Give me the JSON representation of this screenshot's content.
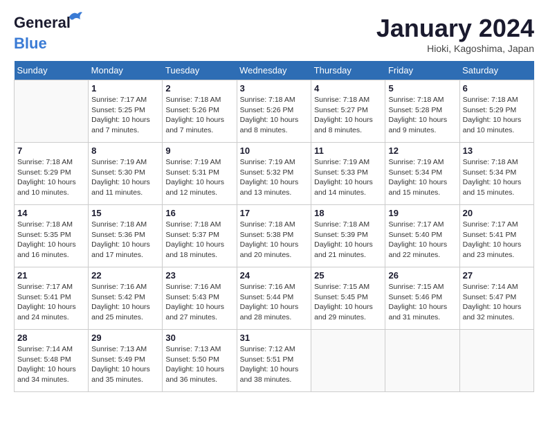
{
  "header": {
    "logo_line1": "General",
    "logo_line2": "Blue",
    "month": "January 2024",
    "location": "Hioki, Kagoshima, Japan"
  },
  "weekdays": [
    "Sunday",
    "Monday",
    "Tuesday",
    "Wednesday",
    "Thursday",
    "Friday",
    "Saturday"
  ],
  "weeks": [
    [
      {
        "day": "",
        "info": ""
      },
      {
        "day": "1",
        "info": "Sunrise: 7:17 AM\nSunset: 5:25 PM\nDaylight: 10 hours\nand 7 minutes."
      },
      {
        "day": "2",
        "info": "Sunrise: 7:18 AM\nSunset: 5:26 PM\nDaylight: 10 hours\nand 7 minutes."
      },
      {
        "day": "3",
        "info": "Sunrise: 7:18 AM\nSunset: 5:26 PM\nDaylight: 10 hours\nand 8 minutes."
      },
      {
        "day": "4",
        "info": "Sunrise: 7:18 AM\nSunset: 5:27 PM\nDaylight: 10 hours\nand 8 minutes."
      },
      {
        "day": "5",
        "info": "Sunrise: 7:18 AM\nSunset: 5:28 PM\nDaylight: 10 hours\nand 9 minutes."
      },
      {
        "day": "6",
        "info": "Sunrise: 7:18 AM\nSunset: 5:29 PM\nDaylight: 10 hours\nand 10 minutes."
      }
    ],
    [
      {
        "day": "7",
        "info": "Sunrise: 7:18 AM\nSunset: 5:29 PM\nDaylight: 10 hours\nand 10 minutes."
      },
      {
        "day": "8",
        "info": "Sunrise: 7:19 AM\nSunset: 5:30 PM\nDaylight: 10 hours\nand 11 minutes."
      },
      {
        "day": "9",
        "info": "Sunrise: 7:19 AM\nSunset: 5:31 PM\nDaylight: 10 hours\nand 12 minutes."
      },
      {
        "day": "10",
        "info": "Sunrise: 7:19 AM\nSunset: 5:32 PM\nDaylight: 10 hours\nand 13 minutes."
      },
      {
        "day": "11",
        "info": "Sunrise: 7:19 AM\nSunset: 5:33 PM\nDaylight: 10 hours\nand 14 minutes."
      },
      {
        "day": "12",
        "info": "Sunrise: 7:19 AM\nSunset: 5:34 PM\nDaylight: 10 hours\nand 15 minutes."
      },
      {
        "day": "13",
        "info": "Sunrise: 7:18 AM\nSunset: 5:34 PM\nDaylight: 10 hours\nand 15 minutes."
      }
    ],
    [
      {
        "day": "14",
        "info": "Sunrise: 7:18 AM\nSunset: 5:35 PM\nDaylight: 10 hours\nand 16 minutes."
      },
      {
        "day": "15",
        "info": "Sunrise: 7:18 AM\nSunset: 5:36 PM\nDaylight: 10 hours\nand 17 minutes."
      },
      {
        "day": "16",
        "info": "Sunrise: 7:18 AM\nSunset: 5:37 PM\nDaylight: 10 hours\nand 18 minutes."
      },
      {
        "day": "17",
        "info": "Sunrise: 7:18 AM\nSunset: 5:38 PM\nDaylight: 10 hours\nand 20 minutes."
      },
      {
        "day": "18",
        "info": "Sunrise: 7:18 AM\nSunset: 5:39 PM\nDaylight: 10 hours\nand 21 minutes."
      },
      {
        "day": "19",
        "info": "Sunrise: 7:17 AM\nSunset: 5:40 PM\nDaylight: 10 hours\nand 22 minutes."
      },
      {
        "day": "20",
        "info": "Sunrise: 7:17 AM\nSunset: 5:41 PM\nDaylight: 10 hours\nand 23 minutes."
      }
    ],
    [
      {
        "day": "21",
        "info": "Sunrise: 7:17 AM\nSunset: 5:41 PM\nDaylight: 10 hours\nand 24 minutes."
      },
      {
        "day": "22",
        "info": "Sunrise: 7:16 AM\nSunset: 5:42 PM\nDaylight: 10 hours\nand 25 minutes."
      },
      {
        "day": "23",
        "info": "Sunrise: 7:16 AM\nSunset: 5:43 PM\nDaylight: 10 hours\nand 27 minutes."
      },
      {
        "day": "24",
        "info": "Sunrise: 7:16 AM\nSunset: 5:44 PM\nDaylight: 10 hours\nand 28 minutes."
      },
      {
        "day": "25",
        "info": "Sunrise: 7:15 AM\nSunset: 5:45 PM\nDaylight: 10 hours\nand 29 minutes."
      },
      {
        "day": "26",
        "info": "Sunrise: 7:15 AM\nSunset: 5:46 PM\nDaylight: 10 hours\nand 31 minutes."
      },
      {
        "day": "27",
        "info": "Sunrise: 7:14 AM\nSunset: 5:47 PM\nDaylight: 10 hours\nand 32 minutes."
      }
    ],
    [
      {
        "day": "28",
        "info": "Sunrise: 7:14 AM\nSunset: 5:48 PM\nDaylight: 10 hours\nand 34 minutes."
      },
      {
        "day": "29",
        "info": "Sunrise: 7:13 AM\nSunset: 5:49 PM\nDaylight: 10 hours\nand 35 minutes."
      },
      {
        "day": "30",
        "info": "Sunrise: 7:13 AM\nSunset: 5:50 PM\nDaylight: 10 hours\nand 36 minutes."
      },
      {
        "day": "31",
        "info": "Sunrise: 7:12 AM\nSunset: 5:51 PM\nDaylight: 10 hours\nand 38 minutes."
      },
      {
        "day": "",
        "info": ""
      },
      {
        "day": "",
        "info": ""
      },
      {
        "day": "",
        "info": ""
      }
    ]
  ]
}
